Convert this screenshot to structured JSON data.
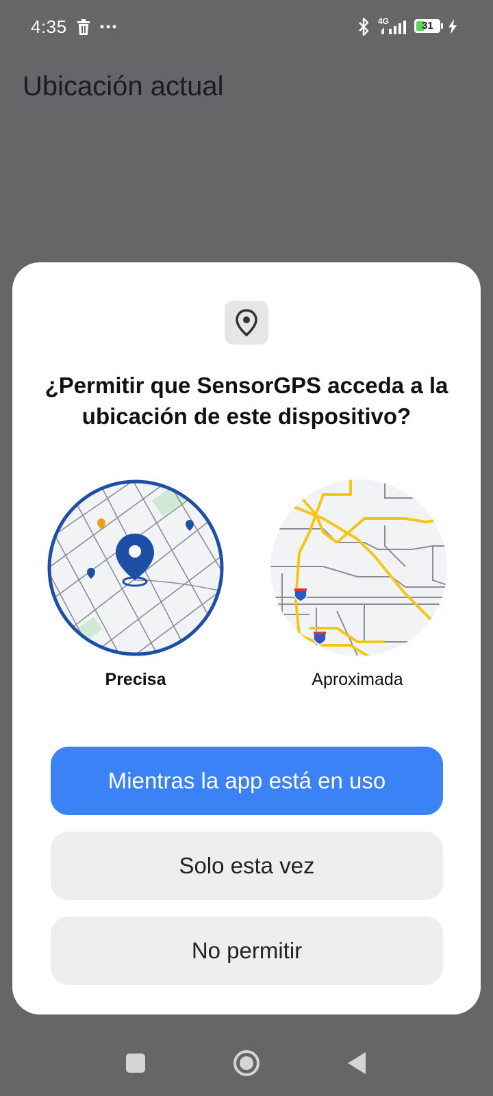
{
  "status_bar": {
    "time": "4:35",
    "network": "4G",
    "battery": "31",
    "icons": [
      "trash-icon",
      "more-dots-icon",
      "bluetooth-icon",
      "signal-icon",
      "battery-icon",
      "charging-icon"
    ]
  },
  "app": {
    "title": "Ubicación actual"
  },
  "dialog": {
    "icon": "location-pin-icon",
    "title": "¿Permitir que SensorGPS acceda a la ubicación de este dispositivo?",
    "options": {
      "precise_label": "Precisa",
      "approx_label": "Aproximada",
      "selected": "precise"
    },
    "buttons": {
      "while_using": "Mientras la app está en uso",
      "only_this_time": "Solo esta vez",
      "deny": "No permitir"
    }
  },
  "nav_bar": {
    "icons": [
      "recents-square-icon",
      "home-circle-icon",
      "back-triangle-icon"
    ]
  },
  "colors": {
    "primary": "#3b82f6",
    "selected_ring": "#1c4fa5",
    "road": "#f5c518",
    "scrim": "#666567"
  }
}
